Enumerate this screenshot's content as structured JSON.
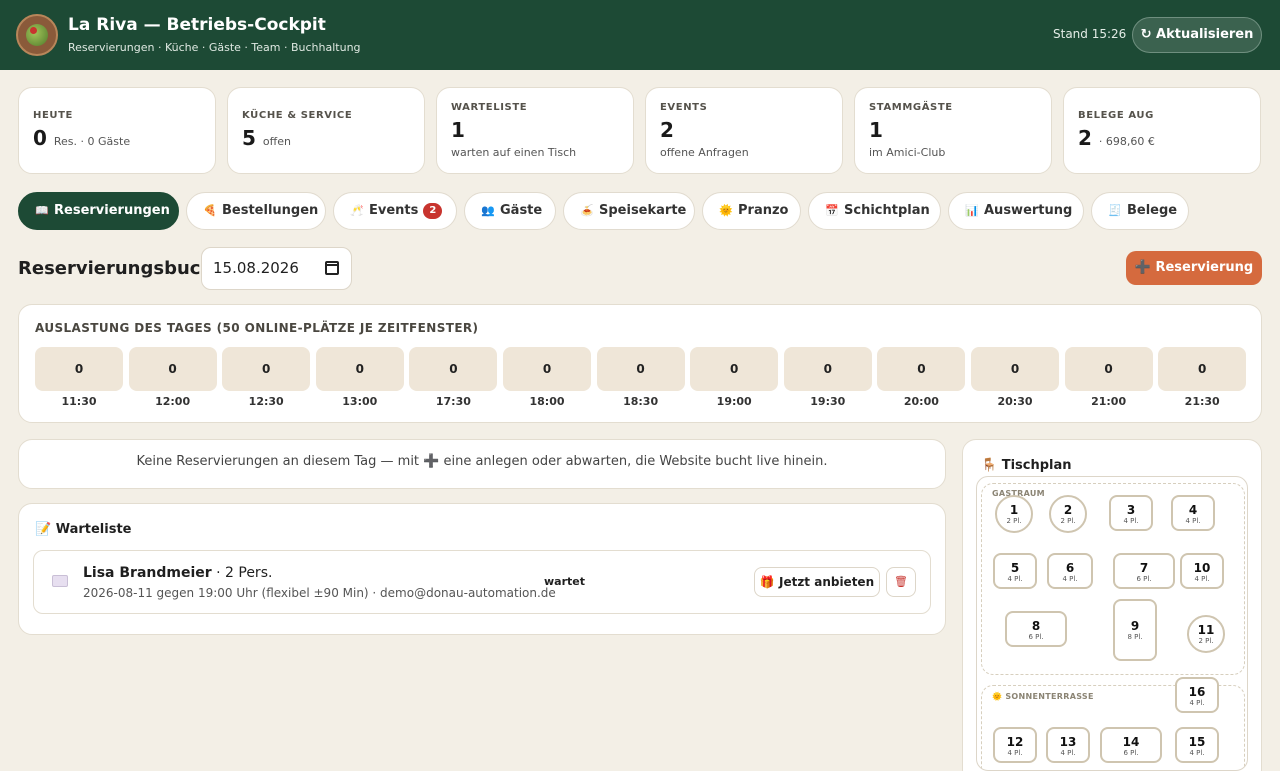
{
  "header": {
    "title": "La Riva — Betriebs-Cockpit",
    "subtitle": "Reservierungen · Küche · Gäste · Team · Buchhaltung",
    "stand": "Stand 15:26",
    "refresh_label": "↻ Aktualisieren"
  },
  "cards": [
    {
      "label": "HEUTE",
      "value": "0",
      "unit": "Res. · 0 Gäste",
      "sub": ""
    },
    {
      "label": "KÜCHE & SERVICE",
      "value": "5",
      "unit": "offen",
      "sub": ""
    },
    {
      "label": "WARTELISTE",
      "value": "1",
      "unit": "",
      "sub": "warten auf einen Tisch"
    },
    {
      "label": "EVENTS",
      "value": "2",
      "unit": "",
      "sub": "offene Anfragen"
    },
    {
      "label": "STAMMGÄSTE",
      "value": "1",
      "unit": "",
      "sub": "im Amici-Club"
    },
    {
      "label": "BELEGE AUG",
      "value": "2",
      "unit": "· 698,60 €",
      "sub": ""
    }
  ],
  "tabs": [
    {
      "icon": "📖",
      "label": "Reservierungen",
      "badge": ""
    },
    {
      "icon": "🍕",
      "label": "Bestellungen",
      "badge": ""
    },
    {
      "icon": "🥂",
      "label": "Events",
      "badge": "2"
    },
    {
      "icon": "👥",
      "label": "Gäste",
      "badge": ""
    },
    {
      "icon": "🍝",
      "label": "Speisekarte",
      "badge": ""
    },
    {
      "icon": "🌞",
      "label": "Pranzo",
      "badge": ""
    },
    {
      "icon": "📅",
      "label": "Schichtplan",
      "badge": ""
    },
    {
      "icon": "📊",
      "label": "Auswertung",
      "badge": ""
    },
    {
      "icon": "🧾",
      "label": "Belege",
      "badge": ""
    }
  ],
  "reservierungsbuch": {
    "title": "Reservierungsbuch",
    "date": "15.08.2026",
    "add_label": "➕ Reservierung"
  },
  "utilization": {
    "title": "AUSLASTUNG DES TAGES (50 ONLINE-PLÄTZE JE ZEITFENSTER)",
    "slots": [
      {
        "time": "11:30",
        "count": "0"
      },
      {
        "time": "12:00",
        "count": "0"
      },
      {
        "time": "12:30",
        "count": "0"
      },
      {
        "time": "13:00",
        "count": "0"
      },
      {
        "time": "17:30",
        "count": "0"
      },
      {
        "time": "18:00",
        "count": "0"
      },
      {
        "time": "18:30",
        "count": "0"
      },
      {
        "time": "19:00",
        "count": "0"
      },
      {
        "time": "19:30",
        "count": "0"
      },
      {
        "time": "20:00",
        "count": "0"
      },
      {
        "time": "20:30",
        "count": "0"
      },
      {
        "time": "21:00",
        "count": "0"
      },
      {
        "time": "21:30",
        "count": "0"
      }
    ]
  },
  "empty_notice": "Keine Reservierungen an diesem Tag — mit ➕ eine anlegen oder abwarten, die Website bucht live hinein.",
  "waitlist": {
    "title": "📝 Warteliste",
    "entries": [
      {
        "name": "Lisa Brandmeier",
        "persons": " · 2 Pers.",
        "meta": "2026-08-11 gegen 19:00 Uhr (flexibel ±90 Min) · demo@donau-automation.de",
        "status": "wartet",
        "offer_label": "🎁 Jetzt anbieten",
        "delete_icon": "🗑"
      }
    ]
  },
  "tischplan": {
    "title": "🪑 Tischplan",
    "zones": [
      {
        "label": "GASTRAUM"
      },
      {
        "label": "🌞 SONNENTERRASSE"
      }
    ],
    "tables": [
      {
        "n": "1",
        "p": "2 Pl."
      },
      {
        "n": "2",
        "p": "2 Pl."
      },
      {
        "n": "3",
        "p": "4 Pl."
      },
      {
        "n": "4",
        "p": "4 Pl."
      },
      {
        "n": "5",
        "p": "4 Pl."
      },
      {
        "n": "6",
        "p": "4 Pl."
      },
      {
        "n": "7",
        "p": "6 Pl."
      },
      {
        "n": "10",
        "p": "4 Pl."
      },
      {
        "n": "8",
        "p": "6 Pl."
      },
      {
        "n": "9",
        "p": "8 Pl."
      },
      {
        "n": "11",
        "p": "2 Pl."
      },
      {
        "n": "16",
        "p": "4 Pl."
      },
      {
        "n": "12",
        "p": "4 Pl."
      },
      {
        "n": "13",
        "p": "4 Pl."
      },
      {
        "n": "14",
        "p": "6 Pl."
      },
      {
        "n": "15",
        "p": "4 Pl."
      }
    ]
  }
}
